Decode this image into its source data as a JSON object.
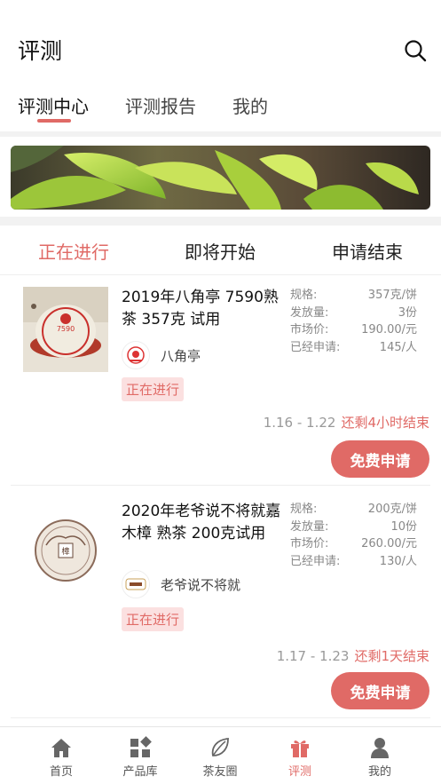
{
  "header": {
    "title": "评测"
  },
  "tabs": [
    {
      "label": "评测中心",
      "active": true
    },
    {
      "label": "评测报告",
      "active": false
    },
    {
      "label": "我的",
      "active": false
    }
  ],
  "status_tabs": [
    {
      "label": "正在进行",
      "active": true
    },
    {
      "label": "即将开始",
      "active": false
    },
    {
      "label": "申请结束",
      "active": false
    }
  ],
  "products": [
    {
      "name": "2019年八角亭 7590熟茶 357克 试用",
      "brand": "八角亭",
      "badge": "正在进行",
      "specs": [
        {
          "label": "规格:",
          "value": "357克/饼"
        },
        {
          "label": "发放量:",
          "value": "3份"
        },
        {
          "label": "市场价:",
          "value": "190.00/元"
        },
        {
          "label": "已经申请:",
          "value": "145/人"
        }
      ],
      "date_range": "1.16 - 1.22",
      "remaining": "还剩4小时结束",
      "apply_label": "免费申请"
    },
    {
      "name": "2020年老爷说不将就嘉木樟 熟茶 200克试用",
      "brand": "老爷说不将就",
      "badge": "正在进行",
      "specs": [
        {
          "label": "规格:",
          "value": "200克/饼"
        },
        {
          "label": "发放量:",
          "value": "10份"
        },
        {
          "label": "市场价:",
          "value": "260.00/元"
        },
        {
          "label": "已经申请:",
          "value": "130/人"
        }
      ],
      "date_range": "1.17 - 1.23",
      "remaining": "还剩1天结束",
      "apply_label": "免费申请"
    }
  ],
  "bottom_nav": [
    {
      "label": "首页",
      "icon": "home-icon",
      "active": false
    },
    {
      "label": "产品库",
      "icon": "grid-icon",
      "active": false
    },
    {
      "label": "茶友圈",
      "icon": "leaf-icon",
      "active": false
    },
    {
      "label": "评测",
      "icon": "gift-icon",
      "active": true
    },
    {
      "label": "我的",
      "icon": "person-icon",
      "active": false
    }
  ],
  "colors": {
    "accent": "#e06a66",
    "badge_bg": "#fbe0e0"
  }
}
